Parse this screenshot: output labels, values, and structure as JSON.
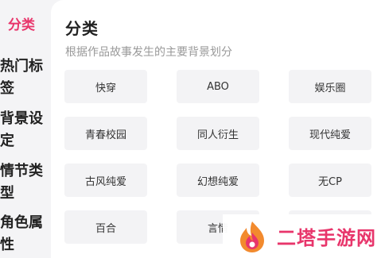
{
  "sidebar": {
    "items": [
      {
        "label": "分类",
        "active": true
      },
      {
        "label": "热门标签"
      },
      {
        "label": "背景设定"
      },
      {
        "label": "情节类型"
      },
      {
        "label": "角色属性"
      }
    ]
  },
  "main": {
    "title": "分类",
    "subtitle": "根据作品故事发生的主要背景划分",
    "tags": [
      "快穿",
      "ABO",
      "娱乐圈",
      "青春校园",
      "同人衍生",
      "现代纯爱",
      "古风纯爱",
      "幻想纯爱",
      "无CP",
      "百合",
      "言情"
    ]
  },
  "watermark": {
    "text": "二塔手游网"
  },
  "colors": {
    "accent": "#e8356b",
    "tag_bg": "#f3f3f5",
    "sidebar_bg": "#f4f4f6"
  }
}
